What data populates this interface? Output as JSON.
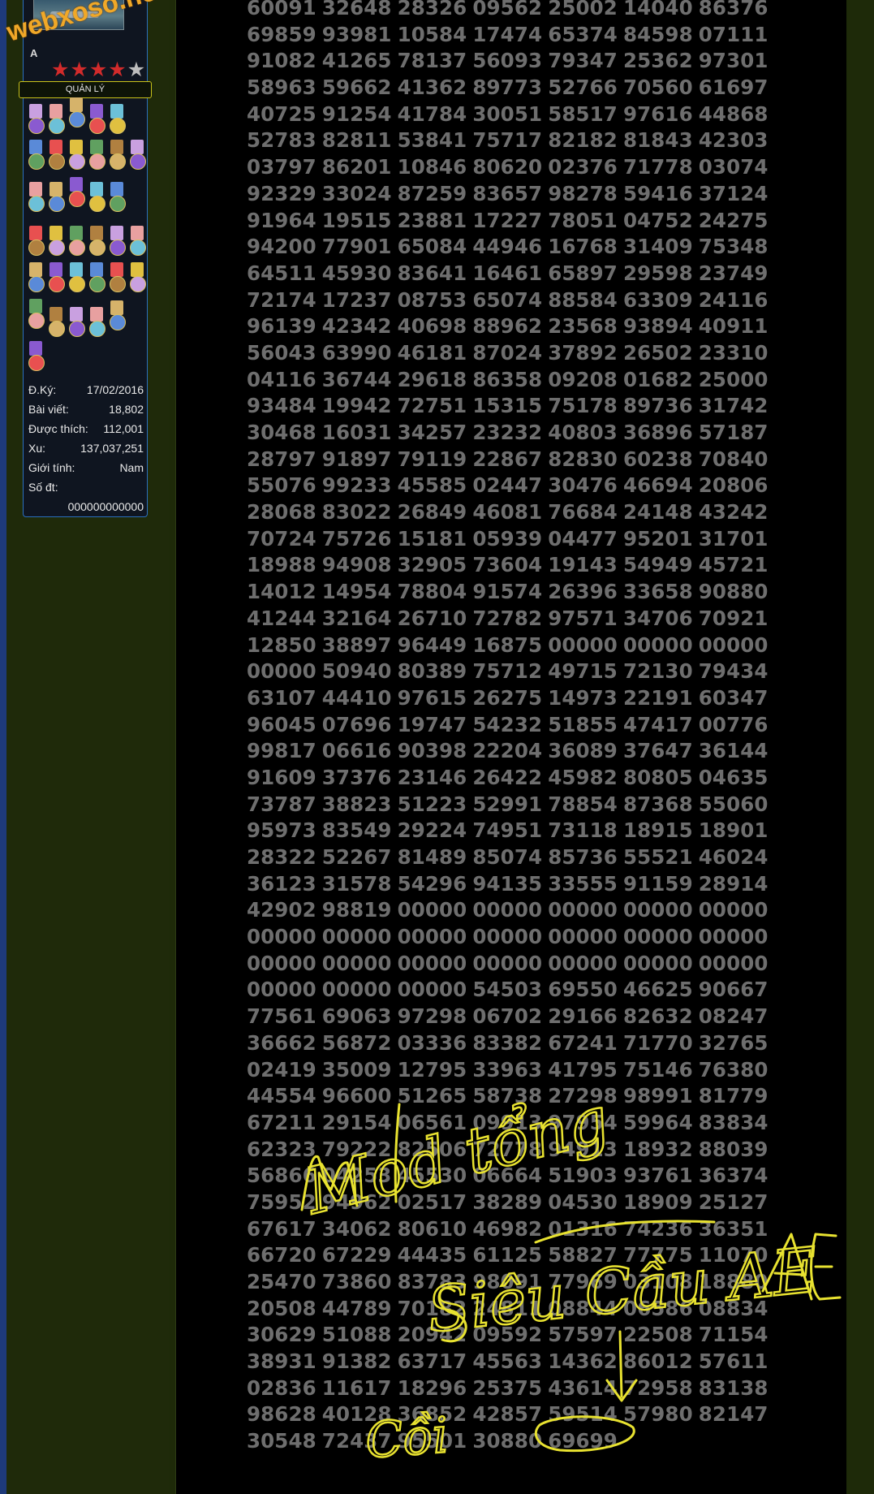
{
  "watermark": "webxoso.net  web",
  "user": {
    "name": "A",
    "stars_filled": 4,
    "stars_total": 5,
    "role": "QUẢN LÝ",
    "info": [
      {
        "label": "Đ.Ký:",
        "value": "17/02/2016"
      },
      {
        "label": "Bài viết:",
        "value": "18,802"
      },
      {
        "label": "Được thích:",
        "value": "112,001"
      },
      {
        "label": "Xu:",
        "value": "137,037,251"
      },
      {
        "label": "Giới tính:",
        "value": "Nam"
      },
      {
        "label": "Số đt:",
        "value": ""
      }
    ],
    "phone": "000000000000",
    "medal_palette": [
      "#c9a0e0",
      "#e8a0a0",
      "#d6b36a",
      "#8a5ad0",
      "#6cc0d8",
      "#5a8ad8",
      "#e85050",
      "#e0c040",
      "#60a060",
      "#b08040"
    ]
  },
  "number_rows": [
    [
      "60091",
      "32648",
      "28326",
      "09562",
      "25002",
      "14040",
      "86376"
    ],
    [
      "69859",
      "93981",
      "10584",
      "17474",
      "65374",
      "84598",
      "07111"
    ],
    [
      "91082",
      "41265",
      "78137",
      "56093",
      "79347",
      "25362",
      "97301"
    ],
    [
      "58963",
      "59662",
      "41362",
      "89773",
      "52766",
      "70560",
      "61697"
    ],
    [
      "40725",
      "91254",
      "41784",
      "30051",
      "58517",
      "97616",
      "44868"
    ],
    [
      "52783",
      "82811",
      "53841",
      "75717",
      "82182",
      "81843",
      "42303"
    ],
    [
      "03797",
      "86201",
      "10846",
      "80620",
      "02376",
      "71778",
      "03074"
    ],
    [
      "92329",
      "33024",
      "87259",
      "83657",
      "98278",
      "59416",
      "37124"
    ],
    [
      "91964",
      "19515",
      "23881",
      "17227",
      "78051",
      "04752",
      "24275"
    ],
    [
      "94200",
      "77901",
      "65084",
      "44946",
      "16768",
      "31409",
      "75348"
    ],
    [
      "64511",
      "45930",
      "83641",
      "16461",
      "65897",
      "29598",
      "23749"
    ],
    [
      "72174",
      "17237",
      "08753",
      "65074",
      "88584",
      "63309",
      "24116"
    ],
    [
      "96139",
      "42342",
      "40698",
      "88962",
      "23568",
      "93894",
      "40911"
    ],
    [
      "56043",
      "63990",
      "46181",
      "87024",
      "37892",
      "26502",
      "23310"
    ],
    [
      "04116",
      "36744",
      "29618",
      "86358",
      "09208",
      "01682",
      "25000"
    ],
    [
      "93484",
      "19942",
      "72751",
      "15315",
      "75178",
      "89736",
      "31742"
    ],
    [
      "30468",
      "16031",
      "34257",
      "23232",
      "40803",
      "36896",
      "57187"
    ],
    [
      "28797",
      "91897",
      "79119",
      "22867",
      "82830",
      "60238",
      "70840"
    ],
    [
      "55076",
      "99233",
      "45585",
      "02447",
      "30476",
      "46694",
      "20806"
    ],
    [
      "28068",
      "83022",
      "26849",
      "46081",
      "76684",
      "24148",
      "43242"
    ],
    [
      "70724",
      "75726",
      "15181",
      "05939",
      "04477",
      "95201",
      "31701"
    ],
    [
      "18988",
      "94908",
      "32905",
      "73604",
      "19143",
      "54949",
      "45721"
    ],
    [
      "14012",
      "14954",
      "78804",
      "91574",
      "26396",
      "33658",
      "90880"
    ],
    [
      "41244",
      "32164",
      "26710",
      "72782",
      "97571",
      "34706",
      "70921"
    ],
    [
      "12850",
      "38897",
      "96449",
      "16875",
      "00000",
      "00000",
      "00000"
    ],
    [
      "00000",
      "50940",
      "80389",
      "75712",
      "49715",
      "72130",
      "79434"
    ],
    [
      "63107",
      "44410",
      "97615",
      "26275",
      "14973",
      "22191",
      "60347"
    ],
    [
      "96045",
      "07696",
      "19747",
      "54232",
      "51855",
      "47417",
      "00776"
    ],
    [
      "99817",
      "06616",
      "90398",
      "22204",
      "36089",
      "37647",
      "36144"
    ],
    [
      "91609",
      "37376",
      "23146",
      "26422",
      "45982",
      "80805",
      "04635"
    ],
    [
      "73787",
      "38823",
      "51223",
      "52991",
      "78854",
      "87368",
      "55060"
    ],
    [
      "95973",
      "83549",
      "29224",
      "74951",
      "73118",
      "18915",
      "18901"
    ],
    [
      "28322",
      "52267",
      "81489",
      "85074",
      "85736",
      "55521",
      "46024"
    ],
    [
      "36123",
      "31578",
      "54296",
      "94135",
      "33555",
      "91159",
      "28914"
    ],
    [
      "42902",
      "98819",
      "00000",
      "00000",
      "00000",
      "00000",
      "00000"
    ],
    [
      "00000",
      "00000",
      "00000",
      "00000",
      "00000",
      "00000",
      "00000"
    ],
    [
      "00000",
      "00000",
      "00000",
      "00000",
      "00000",
      "00000",
      "00000"
    ],
    [
      "00000",
      "00000",
      "00000",
      "54503",
      "69550",
      "46625",
      "90667"
    ],
    [
      "77561",
      "69063",
      "97298",
      "06702",
      "29166",
      "82632",
      "08247"
    ],
    [
      "36662",
      "56872",
      "03336",
      "83382",
      "67241",
      "71770",
      "32765"
    ],
    [
      "02419",
      "35009",
      "12795",
      "33963",
      "41795",
      "75146",
      "76380"
    ],
    [
      "44554",
      "96600",
      "51265",
      "58738",
      "27298",
      "98991",
      "81779"
    ],
    [
      "67211",
      "29154",
      "06561",
      "09913",
      "97954",
      "59964",
      "83834"
    ],
    [
      "62323",
      "79222",
      "82506",
      "72778",
      "94913",
      "18932",
      "88039"
    ],
    [
      "56866",
      "04253",
      "45530",
      "06664",
      "51903",
      "93761",
      "36374"
    ],
    [
      "75952",
      "94962",
      "02517",
      "38289",
      "04530",
      "18909",
      "25127"
    ],
    [
      "67617",
      "34062",
      "80610",
      "46982",
      "01316",
      "74236",
      "36351"
    ],
    [
      "66720",
      "67229",
      "44435",
      "61125",
      "58827",
      "77775",
      "11070"
    ],
    [
      "25470",
      "73860",
      "83783",
      "98091",
      "77969",
      "03108",
      "18880"
    ],
    [
      "20508",
      "44789",
      "70182",
      "24811",
      "08844",
      "06586",
      "08834"
    ],
    [
      "30629",
      "51088",
      "20942",
      "09592",
      "57597",
      "22508",
      "71154"
    ],
    [
      "38931",
      "91382",
      "63717",
      "45563",
      "14362",
      "86012",
      "57611"
    ],
    [
      "02836",
      "11617",
      "18296",
      "25375",
      "43614",
      "72958",
      "83138"
    ],
    [
      "98628",
      "40128",
      "36852",
      "42857",
      "59514",
      "57980",
      "82147"
    ],
    [
      "30548",
      "72437",
      "95501",
      "30880",
      "69699"
    ]
  ],
  "annotation": {
    "line1": "Mod tổng",
    "line2": "Siêu Cầu AE",
    "line3": "Cồi"
  }
}
